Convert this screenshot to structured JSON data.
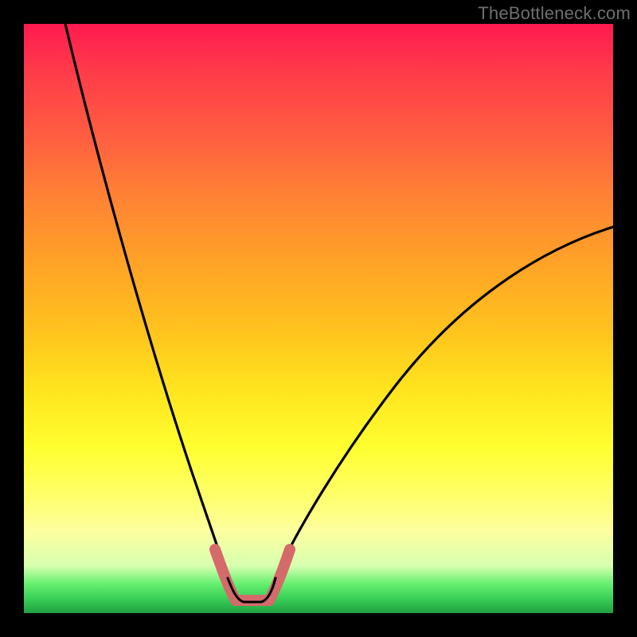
{
  "watermark": "TheBottleneck.com",
  "colors": {
    "frame": "#000000",
    "gradient_top": "#ff1a50",
    "gradient_mid": "#ffe41e",
    "gradient_bottom": "#20a040",
    "curve": "#000000",
    "optimal_band": "#d46a6a"
  },
  "chart_data": {
    "type": "line",
    "title": "",
    "xlabel": "",
    "ylabel": "",
    "xlim": [
      0,
      100
    ],
    "ylim": [
      0,
      100
    ],
    "note": "V-shaped bottleneck curve; y≈0 (green) means balanced. Minimum near x≈35–42. Values estimated from pixel positions.",
    "series": [
      {
        "name": "left-branch",
        "x": [
          7,
          10,
          13,
          16,
          19,
          22,
          25,
          28,
          31,
          34
        ],
        "y": [
          100,
          88,
          77,
          66,
          55,
          44,
          34,
          24,
          14,
          6
        ]
      },
      {
        "name": "right-branch",
        "x": [
          42,
          46,
          50,
          55,
          60,
          66,
          73,
          80,
          88,
          96,
          100
        ],
        "y": [
          6,
          10,
          15,
          21,
          27,
          34,
          41,
          48,
          55,
          62,
          65
        ]
      },
      {
        "name": "optimal-flat",
        "x": [
          34,
          36,
          38,
          40,
          42
        ],
        "y": [
          2,
          1,
          1,
          1,
          2
        ]
      }
    ],
    "optimal_range_x": [
      32,
      44
    ]
  }
}
